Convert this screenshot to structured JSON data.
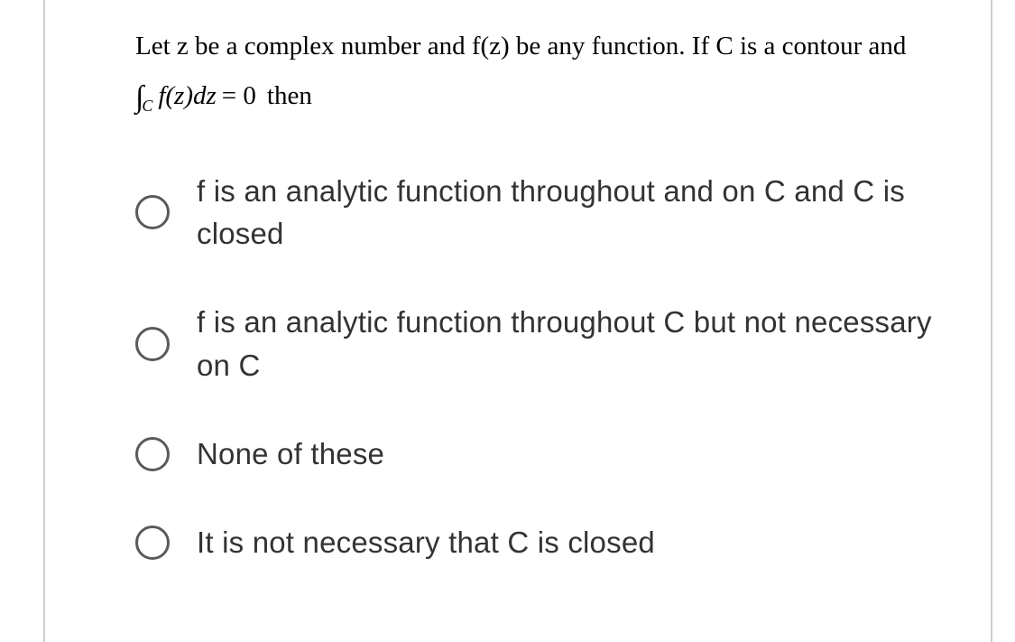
{
  "question": {
    "line1": "Let z be a complex number and f(z) be any function. If C is a contour and",
    "integral_sub": "C",
    "integral_func": "f(z)dz",
    "equals": "= 0",
    "then": "then"
  },
  "options": [
    {
      "text": "f is an analytic function throughout and on C and C is closed"
    },
    {
      "text": "f is an analytic function throughout C but not necessary on C"
    },
    {
      "text": "None of these"
    },
    {
      "text": "It is not necessary that C is closed"
    }
  ]
}
